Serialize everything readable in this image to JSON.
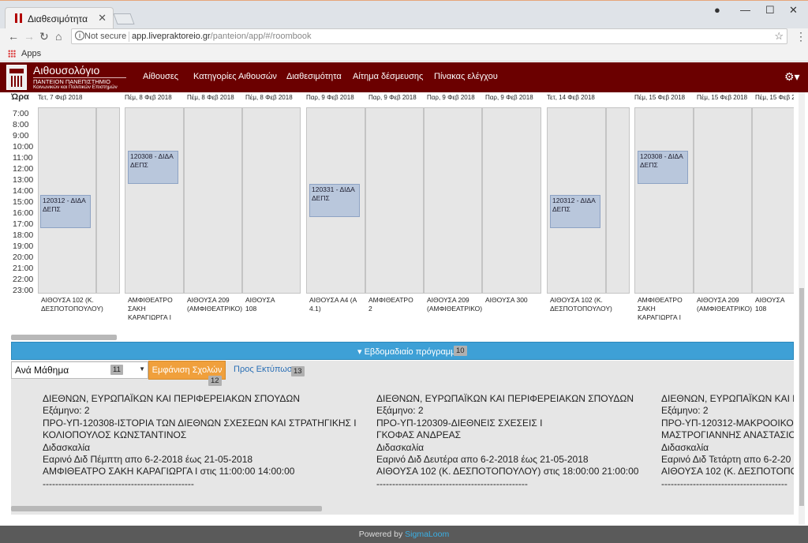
{
  "browser": {
    "tab_title": "Διαθεσιμότητα",
    "not_secure": "Not secure",
    "url_host": "app.livepraktoreio.gr",
    "url_path": "/panteion/app/#/roombook",
    "bookmark_apps": "Apps"
  },
  "header": {
    "title": "Αιθουσολόγιο",
    "sub1": "ΠΑΝΤΕΙΟΝ ΠΑΝΕΠΙΣΤΗΜΙΟ",
    "sub2": "Κοινωνικών και Πολιτικών Επιστημών",
    "nav": [
      "Αίθουσες",
      "Κατηγορίες Αιθουσών",
      "Διαθεσιμότητα",
      "Αίτημα δέσμευσης",
      "Πίνακας ελέγχου"
    ]
  },
  "calendar": {
    "ora": "Ώρα",
    "hours": [
      "7:00",
      "8:00",
      "9:00",
      "10:00",
      "11:00",
      "12:00",
      "13:00",
      "14:00",
      "15:00",
      "16:00",
      "17:00",
      "18:00",
      "19:00",
      "20:00",
      "21:00",
      "22:00",
      "23:00"
    ],
    "columns": [
      {
        "header": "Τετ, 7 Φεβ 2018",
        "room": "ΑΙΘΟΥΣΑ 102 (Κ. ΔΕΣΠΟΤΟΠΟΥΛΟΥ)"
      },
      {
        "header": "Πέμ, 8 Φεβ 2018",
        "room": "ΑΜΦΙΘΕΑΤΡΟ ΣΑΚΗ ΚΑΡΑΓΙΩΡΓΑ Ι"
      },
      {
        "header": "Πέμ, 8 Φεβ 2018",
        "room": "ΑΙΘΟΥΣΑ 209 (ΑΜΦΙΘΕΑΤΡΙΚΟ)"
      },
      {
        "header": "Πέμ, 8 Φεβ 2018",
        "room": "ΑΙΘΟΥΣΑ 108"
      },
      {
        "header": "Παρ, 9 Φεβ 2018",
        "room": "ΑΙΘΟΥΣΑ Α4 (Α 4.1)"
      },
      {
        "header": "Παρ, 9 Φεβ 2018",
        "room": "ΑΜΦΙΘΕΑΤΡΟ 2"
      },
      {
        "header": "Παρ, 9 Φεβ 2018",
        "room": "ΑΙΘΟΥΣΑ 209 (ΑΜΦΙΘΕΑΤΡΙΚΟ)"
      },
      {
        "header": "Παρ, 9 Φεβ 2018",
        "room": "ΑΙΘΟΥΣΑ 300"
      },
      {
        "header": "Τετ, 14 Φεβ 2018",
        "room": "ΑΙΘΟΥΣΑ 102 (Κ. ΔΕΣΠΟΤΟΠΟΥΛΟΥ)"
      },
      {
        "header": "Πέμ, 15 Φεβ 2018",
        "room": "ΑΜΦΙΘΕΑΤΡΟ ΣΑΚΗ ΚΑΡΑΓΙΩΡΓΑ Ι"
      },
      {
        "header": "Πέμ, 15 Φεβ 2018",
        "room": "ΑΙΘΟΥΣΑ 209 (ΑΜΦΙΘΕΑΤΡΙΚΟ)"
      },
      {
        "header": "Πέμ, 15 Φεβ 2018",
        "room": "ΑΙΘΟΥΣΑ 108"
      }
    ],
    "events": [
      {
        "line1": "120312 - ΔΙΔΑ",
        "line2": "ΔΕΠΣ"
      },
      {
        "line1": "120308 - ΔΙΔΑ",
        "line2": "ΔΕΠΣ"
      },
      {
        "line1": "120331 - ΔΙΔΑ",
        "line2": "ΔΕΠΣ"
      },
      {
        "line1": "120312 - ΔΙΔΑ",
        "line2": "ΔΕΠΣ"
      },
      {
        "line1": "120308 - ΔΙΔΑ",
        "line2": "ΔΕΠΣ"
      }
    ]
  },
  "weekly": {
    "label": "Εβδομαδιαίο πρόγραμμα",
    "badge": "10"
  },
  "filters": {
    "select_value": "Ανά Μάθημα",
    "select_badge": "11",
    "show_schools": "Εμφάνιση Σχολών",
    "show_badge": "12",
    "print": "Προς Εκτύπωση",
    "print_badge": "13"
  },
  "courses": [
    {
      "lines": [
        "ΔΙΕΘΝΩΝ, ΕΥΡΩΠΑΪΚΩΝ ΚΑΙ ΠΕΡΙΦΕΡΕΙΑΚΩΝ ΣΠΟΥΔΩΝ",
        "Εξάμηνο: 2",
        "ΠΡΟ-ΥΠ-120308-ΙΣΤΟΡΙΑ ΤΩΝ ΔΙΕΘΝΩΝ ΣΧΕΣΕΩΝ ΚΑΙ ΣΤΡΑΤΗΓΙΚΗΣ Ι",
        "ΚΟΛΙΟΠΟΥΛΟΣ ΚΩΝΣΤΑΝΤΙΝΟΣ",
        "Διδασκαλία",
        "Εαρινό Διδ Πέμπτη απο 6-2-2018 έως 21-05-2018",
        "ΑΜΦΙΘΕΑΤΡΟ ΣΑΚΗ ΚΑΡΑΓΙΩΡΓΑ Ι στις 11:00:00 14:00:00",
        "------------------------------------------------"
      ]
    },
    {
      "lines": [
        "ΔΙΕΘΝΩΝ, ΕΥΡΩΠΑΪΚΩΝ ΚΑΙ ΠΕΡΙΦΕΡΕΙΑΚΩΝ ΣΠΟΥΔΩΝ",
        "Εξάμηνο: 2",
        "ΠΡΟ-ΥΠ-120309-ΔΙΕΘΝΕΙΣ ΣΧΕΣΕΙΣ Ι",
        "ΓΚΟΦΑΣ ΑΝΔΡΕΑΣ",
        "Διδασκαλία",
        "Εαρινό Διδ Δευτέρα απο 6-2-2018 έως 21-05-2018",
        "ΑΙΘΟΥΣΑ 102 (Κ. ΔΕΣΠΟΤΟΠΟΥΛΟΥ) στις 18:00:00 21:00:00",
        "------------------------------------------------"
      ]
    },
    {
      "lines": [
        "ΔΙΕΘΝΩΝ, ΕΥΡΩΠΑΪΚΩΝ ΚΑΙ ΠΕΡΙ",
        "Εξάμηνο: 2",
        "ΠΡΟ-ΥΠ-120312-ΜΑΚΡΟΟΙΚΟΝΟ",
        "ΜΑΣΤΡΟΓΙΑΝΝΗΣ ΑΝΑΣΤΑΣΙΟΣ",
        "Διδασκαλία",
        "Εαρινό Διδ Τετάρτη απο 6-2-20",
        "ΑΙΘΟΥΣΑ 102 (Κ. ΔΕΣΠΟΤΟΠΟΥΛ",
        "----------------------------------------"
      ]
    }
  ],
  "footer": {
    "powered": "Powered by",
    "brand": "SigmaLoom"
  }
}
